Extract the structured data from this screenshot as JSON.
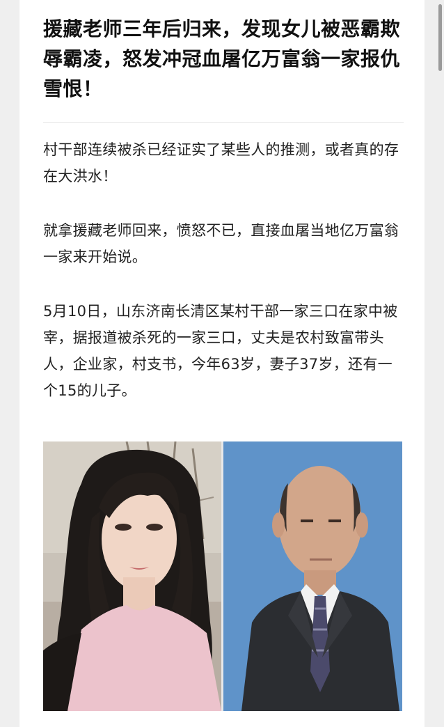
{
  "article": {
    "title": "援藏老师三年后归来，发现女儿被恶霸欺辱霸凌，怒发冲冠血屠亿万富翁一家报仇雪恨！",
    "paragraphs": [
      "村干部连续被杀已经证实了某些人的推测，或者真的存在大洪水！",
      "就拿援藏老师回来，愤怒不已，直接血屠当地亿万富翁一家来开始说。",
      "5月10日，山东济南长清区某村干部一家三口在家中被宰，据报道被杀死的一家三口，丈夫是农村致富带头人，企业家，村支书，今年63岁，妻子37岁，还有一个15的儿子。"
    ]
  },
  "colors": {
    "background": "#efefef",
    "card": "#ffffff",
    "title_text": "#111111",
    "body_text": "#222222",
    "photo_right_bg": "#5f93c9"
  }
}
